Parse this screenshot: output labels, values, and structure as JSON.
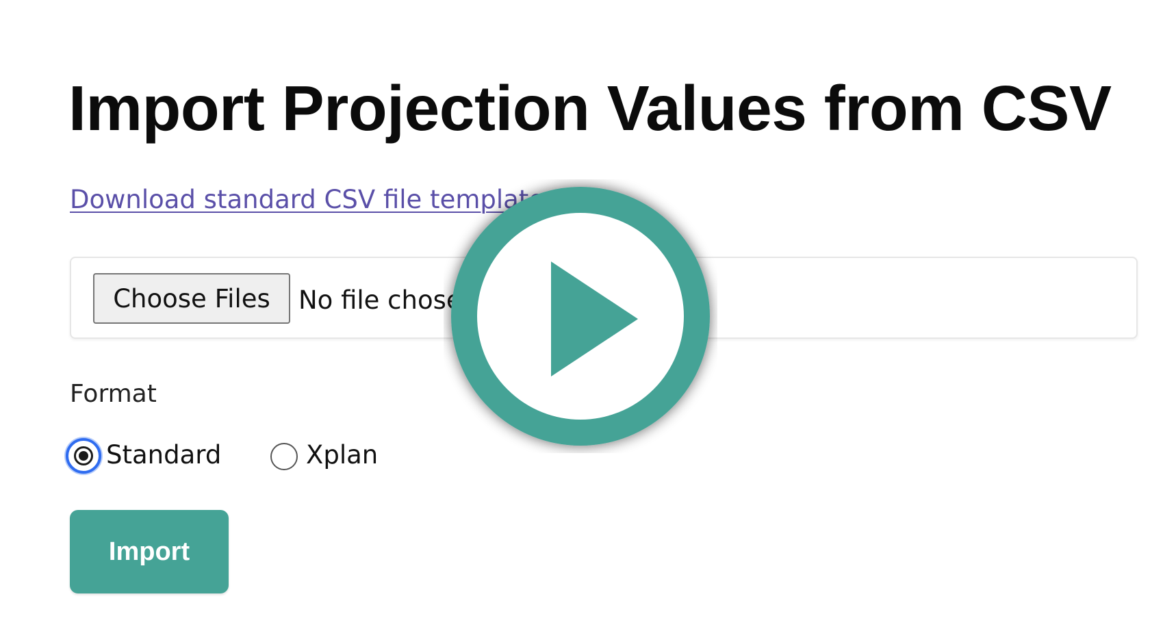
{
  "page": {
    "title": "Import Projection Values from CSV",
    "template_link": "Download standard CSV file template"
  },
  "file_input": {
    "button_label": "Choose Files",
    "status_text": "No file chosen"
  },
  "format": {
    "label": "Format",
    "options": [
      {
        "label": "Standard",
        "selected": true
      },
      {
        "label": "Xplan",
        "selected": false
      }
    ]
  },
  "actions": {
    "import_label": "Import"
  },
  "overlay": {
    "icon": "play-icon"
  },
  "colors": {
    "accent": "#45a396",
    "link": "#5a4fa8",
    "radio_focus": "#2f6cf0"
  }
}
